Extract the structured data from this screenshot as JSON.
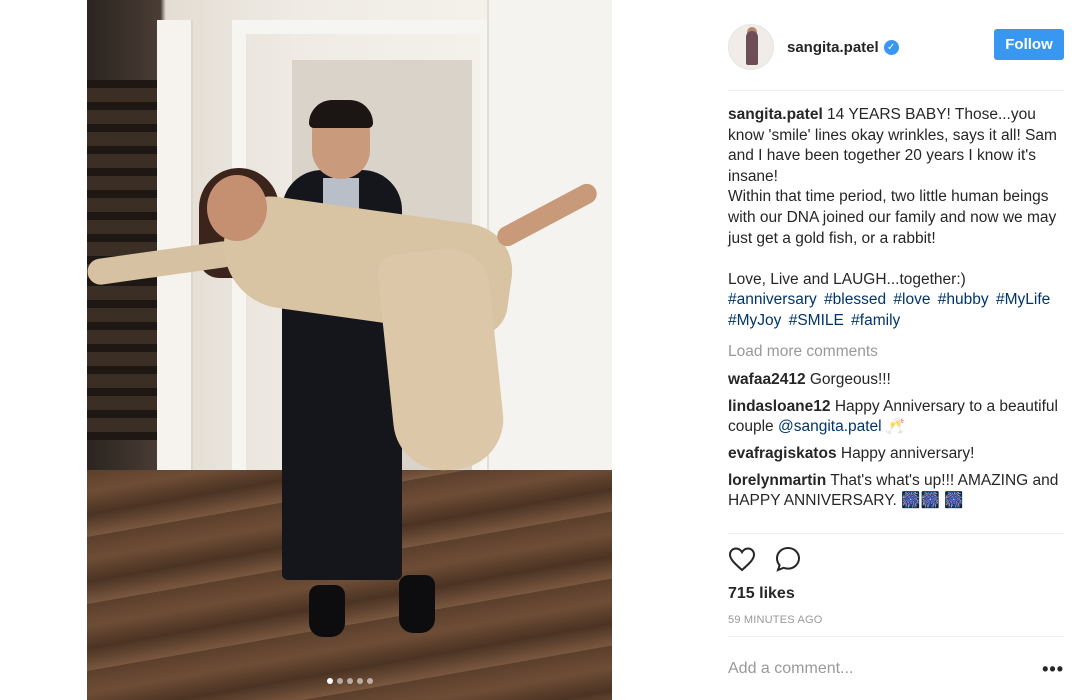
{
  "post": {
    "image_alt": "",
    "carousel": {
      "count": 5,
      "active_index": 0
    }
  },
  "header": {
    "username": "sangita.patel",
    "verified": true,
    "follow_label": "Follow"
  },
  "caption": {
    "author": "sangita.patel",
    "text": " 14 YEARS BABY! Those...you know 'smile' lines okay wrinkles, says it all! Sam and I have been together 20 years I know it's insane!\nWithin that time period, two little human beings with our DNA joined our family and now we may just get a gold fish, or a rabbit!\n\nLove, Live and LAUGH...together:)",
    "hashtags": [
      "#anniversary",
      "#blessed",
      "#love",
      "#hubby",
      "#MyLife",
      "#MyJoy",
      "#SMILE",
      "#family"
    ]
  },
  "load_more_label": "Load more comments",
  "comments": [
    {
      "author": "wafaa2412",
      "text": " Gorgeous!!!"
    },
    {
      "author": "lindasloane12",
      "text": " Happy Anniversary to a beautiful couple ",
      "mention": "@sangita.patel",
      "suffix": " 🥂"
    },
    {
      "author": "evafragiskatos",
      "text": " Happy anniversary!"
    },
    {
      "author": "lorelynmartin",
      "text": " That's what's up!!! AMAZING and HAPPY ANNIVERSARY. 🎆🎆 🎆"
    }
  ],
  "likes_label": "715 likes",
  "timestamp": "59 MINUTES AGO",
  "add_comment": {
    "placeholder": "Add a comment..."
  },
  "icons": {
    "like": "heart-icon",
    "comment": "comment-icon",
    "more": "more-options-icon",
    "verified": "verified-badge-icon"
  },
  "colors": {
    "accent": "#3897f0",
    "link": "#003569",
    "muted": "#999999",
    "text": "#262626"
  }
}
